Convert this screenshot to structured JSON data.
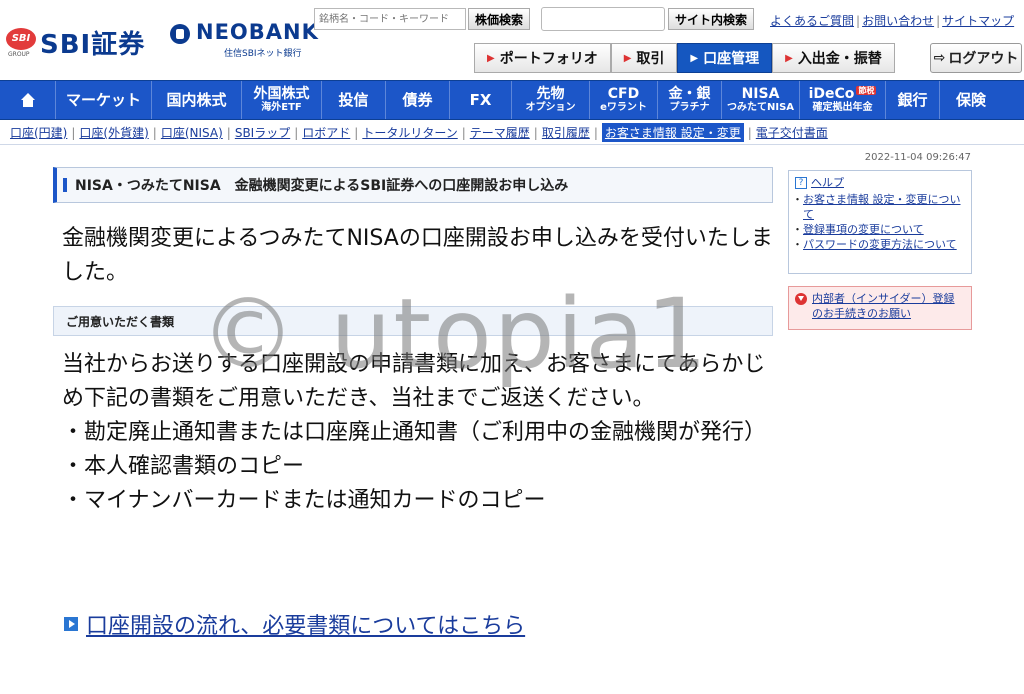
{
  "header": {
    "logo_sbi": "SBI証券",
    "logo_sbi_badge": "SBI",
    "logo_sbi_group": "GROUP",
    "logo_neo": "NEOBANK",
    "logo_neo_sub": "住信SBIネット銀行",
    "search_placeholder": "銘柄名・コード・キーワード",
    "stock_search": "株価検索",
    "site_search": "サイト内検索",
    "top_links": [
      "よくあるご質問",
      "お問い合わせ",
      "サイトマップ"
    ],
    "buttons": [
      "ポートフォリオ",
      "取引",
      "口座管理",
      "入出金・振替"
    ],
    "active_button": "口座管理",
    "logout": "ログアウト"
  },
  "nav": {
    "items": [
      {
        "l1": "マーケット"
      },
      {
        "l1": "国内株式"
      },
      {
        "l1": "外国株式",
        "l2": "海外ETF"
      },
      {
        "l1": "投信"
      },
      {
        "l1": "債券"
      },
      {
        "l1": "FX"
      },
      {
        "l1": "先物",
        "l2": "オプション"
      },
      {
        "l1": "CFD",
        "l2": "eワラント"
      },
      {
        "l1": "金・銀",
        "l2": "プラチナ"
      },
      {
        "l1": "NISA",
        "l2": "つみたてNISA"
      },
      {
        "l1": "iDeCo",
        "l2": "確定拠出年金",
        "badge": "節税"
      },
      {
        "l1": "銀行"
      },
      {
        "l1": "保険"
      }
    ]
  },
  "subnav": {
    "items": [
      "口座(円建)",
      "口座(外貨建)",
      "口座(NISA)",
      "SBIラップ",
      "ロボアド",
      "トータルリターン",
      "テーマ履歴",
      "取引履歴",
      "お客さま情報 設定・変更",
      "電子交付書面"
    ],
    "current": "お客さま情報 設定・変更"
  },
  "timestamp": "2022-11-04 09:26:47",
  "main": {
    "title": "NISA・つみたてNISA　金融機関変更によるSBI証券への口座開設お申し込み",
    "message": "金融機関変更によるつみたてNISAの口座開設お申し込みを受付いたしました。",
    "prep_heading": "ご用意いただく書類",
    "body_intro": "当社からお送りする口座開設の申請書類に加え、お客さまにてあらかじめ下記の書類をご用意いただき、当社までご返送ください。",
    "body_items": [
      "・勘定廃止通知書または口座廃止通知書（ご利用中の金融機関が発行）",
      "・本人確認書類のコピー",
      "・マイナンバーカードまたは通知カードのコピー"
    ],
    "link": "口座開設の流れ、必要書類についてはこちら"
  },
  "side": {
    "help_title": "ヘルプ",
    "help_links": [
      "お客さま情報 設定・変更について",
      "登録事項の変更について",
      "パスワードの変更方法について"
    ],
    "insider_text": "内部者（インサイダー）登録のお手続きのお願い"
  },
  "watermark": "© utopia1",
  "colors": {
    "brand": "#1c56c8",
    "accent": "#d33333"
  }
}
